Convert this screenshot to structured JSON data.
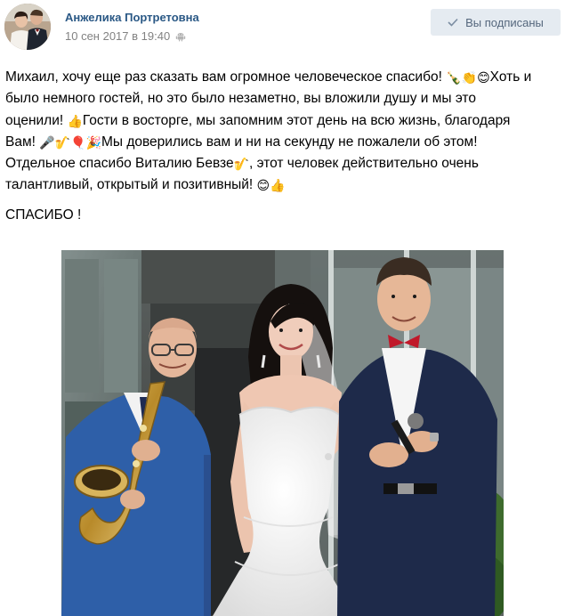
{
  "author": {
    "name": "Анжелика Портретовна",
    "date": "10 сен 2017 в 19:40",
    "avatar_icon": "avatar-wedding-couple"
  },
  "subscribe_button": {
    "label": "Вы подписаны",
    "icon": "check-icon"
  },
  "post": {
    "lines": [
      [
        "Михаил, хочу еще раз сказать вам огромное человеческое спасибо! ",
        "🍾👏😊",
        "Хоть и"
      ],
      [
        "было немного гостей, но это было незаметно, вы вложили душу и мы это",
        "",
        ""
      ],
      [
        "оценили! ",
        "👍",
        "Гости в восторге, мы запомним этот день на всю жизнь, благодаря"
      ],
      [
        "Вам! ",
        "🎤🎷🎈🎉",
        "Мы доверились вам и ни на секунду не пожалели об этом!"
      ],
      [
        "Отдельное спасибо Виталию Бевзе",
        "🎷",
        ", этот человек действительно очень"
      ],
      [
        "талантливый, открытый и позитивный! ",
        "😊👍",
        ""
      ]
    ],
    "closing": "СПАСИБО !"
  },
  "photo": {
    "icon": "wedding-photo"
  },
  "colors": {
    "link": "#2a5885",
    "meta": "#828282",
    "button_bg": "#e5ebf1",
    "button_text": "#55677d"
  }
}
